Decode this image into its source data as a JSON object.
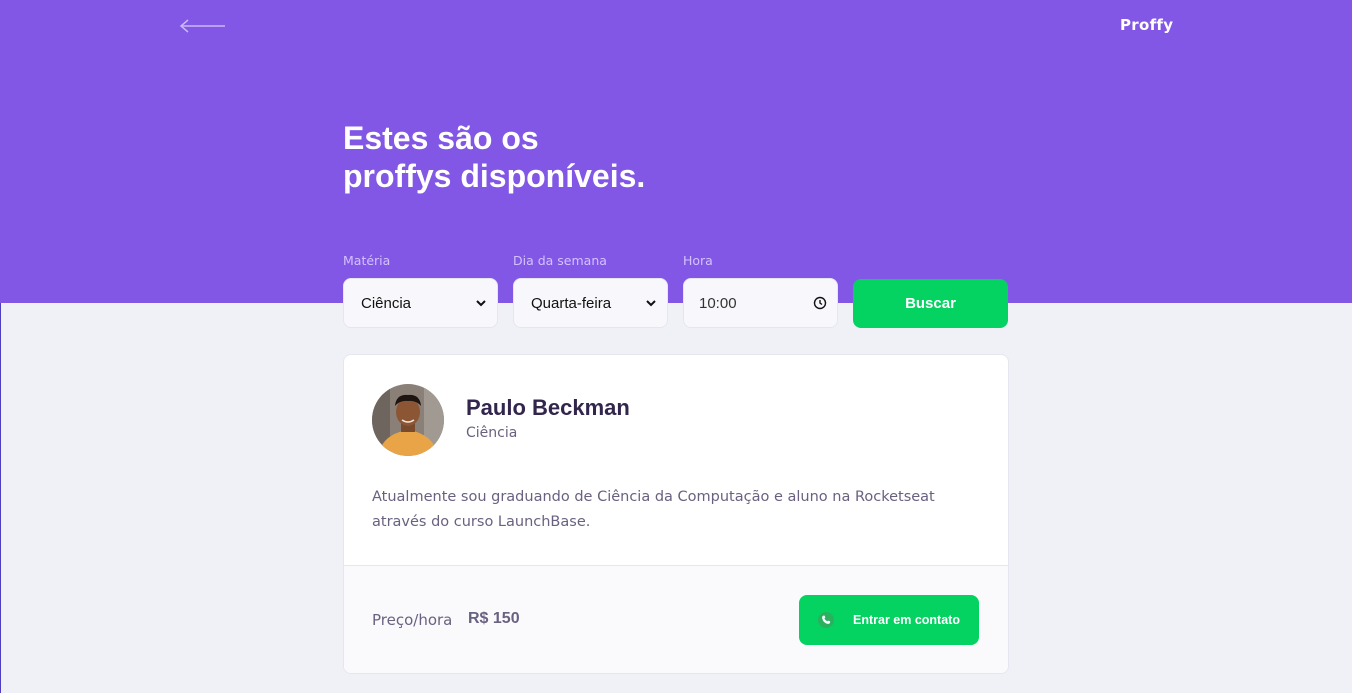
{
  "header": {
    "logo": "Proffy",
    "title_line1": "Estes são os",
    "title_line2": "proffys disponíveis."
  },
  "filters": {
    "subject": {
      "label": "Matéria",
      "value": "Ciência"
    },
    "weekday": {
      "label": "Dia da semana",
      "value": "Quarta-feira"
    },
    "time": {
      "label": "Hora",
      "value": "10:00"
    },
    "search_label": "Buscar"
  },
  "teacher": {
    "name": "Paulo Beckman",
    "subject": "Ciência",
    "bio": "Atualmente sou graduando de Ciência da Computação e aluno na Rocketseat através do curso LaunchBase.",
    "price_label": "Preço/hora",
    "price_value": "R$ 150",
    "contact_label": "Entrar em contato"
  },
  "colors": {
    "primary": "#8257E5",
    "secondary": "#04D361",
    "background": "#F0F0F7",
    "title_text": "#32264D",
    "body_text": "#6A6180"
  },
  "icons": [
    "back-arrow-icon",
    "chevron-down-icon",
    "clock-icon",
    "whatsapp-icon"
  ]
}
